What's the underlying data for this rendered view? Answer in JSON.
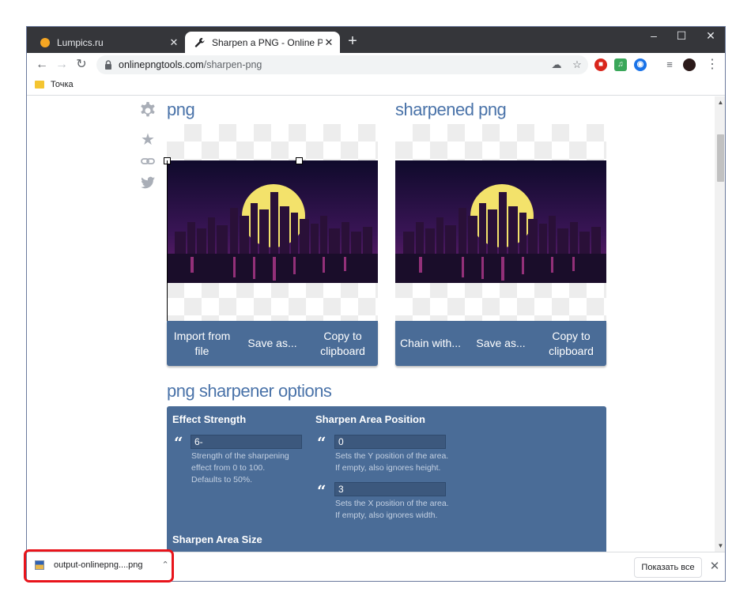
{
  "browser": {
    "tabs": [
      {
        "title": "Lumpics.ru",
        "close": "✕",
        "favicon": "orange-circle-icon"
      },
      {
        "title": "Sharpen a PNG - Online PNG Too",
        "close": "✕",
        "favicon": "wrench-icon"
      }
    ],
    "new_tab": "+",
    "window_controls": {
      "minimize": "–",
      "maximize": "☐",
      "close": "✕"
    },
    "url_host": "onlinepngtools.com",
    "url_path": "/sharpen-png",
    "bookmark": "Точка"
  },
  "page": {
    "input_panel": {
      "title": "png",
      "buttons": [
        "Import from file",
        "Save as...",
        "Copy to clipboard"
      ]
    },
    "output_panel": {
      "title": "sharpened png",
      "buttons": [
        "Chain with...",
        "Save as...",
        "Copy to clipboard"
      ]
    },
    "options": {
      "title": "png sharpener options",
      "effect_strength": {
        "label": "Effect Strength",
        "value": "6-",
        "desc": [
          "Strength of the sharpening",
          "effect from 0 to 100.",
          "Defaults to 50%."
        ]
      },
      "area_position": {
        "label": "Sharpen Area Position",
        "y_value": "0",
        "y_desc": [
          "Sets the Y position of the area.",
          "If empty, also ignores height."
        ],
        "x_value": "3",
        "x_desc": [
          "Sets the X position of the area.",
          "If empty, also ignores width."
        ]
      },
      "area_size": {
        "label": "Sharpen Area Size"
      }
    }
  },
  "downloads": {
    "file": "output-onlinepng....png",
    "show_all": "Показать все",
    "close": "✕"
  },
  "colors": {
    "accent": "#4a73a9",
    "panel": "#4a6c97",
    "highlight": "#e8141b"
  }
}
